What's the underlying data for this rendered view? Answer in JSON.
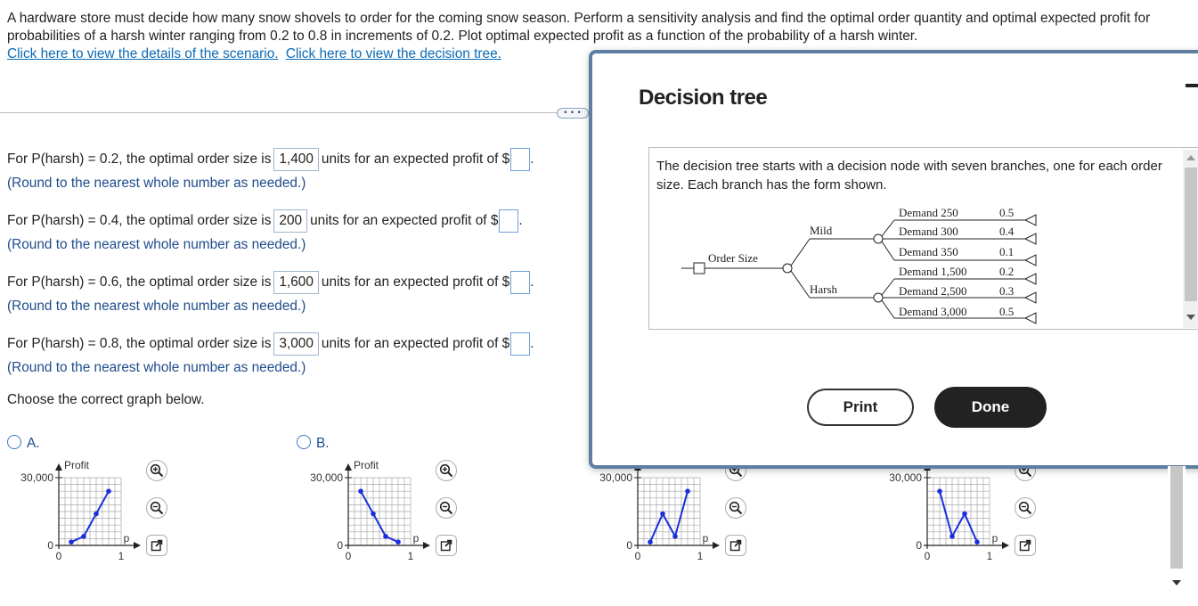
{
  "question": {
    "text": "A hardware store must decide how many snow shovels to order for the coming snow season. Perform a sensitivity analysis and find the optimal order quantity and optimal expected profit for probabilities of a harsh winter ranging from 0.2 to 0.8 in increments of 0.2. Plot optimal expected profit as a function of the probability of a harsh winter.",
    "link_scenario": "Click here to view the details of the scenario.",
    "link_tree": "Click here to view the decision tree."
  },
  "more_label": "• • •",
  "rows": [
    {
      "prefix": "For P(harsh) = 0.2, the optimal order size is",
      "answer": "1,400",
      "middle": "units for an expected profit of $",
      "suffix": ".",
      "hint": "(Round to the nearest whole number as needed.)"
    },
    {
      "prefix": "For P(harsh) = 0.4, the optimal order size is",
      "answer": "200",
      "middle": "units for an expected profit of $",
      "suffix": ".",
      "hint": "(Round to the nearest whole number as needed.)"
    },
    {
      "prefix": "For P(harsh) = 0.6, the optimal order size is",
      "answer": "1,600",
      "middle": "units for an expected profit of $",
      "suffix": ".",
      "hint": "(Round to the nearest whole number as needed.)"
    },
    {
      "prefix": "For P(harsh) = 0.8, the optimal order size is",
      "answer": "3,000",
      "middle": "units for an expected profit of $",
      "suffix": ".",
      "hint": "(Round to the nearest whole number as needed.)"
    }
  ],
  "choose_text": "Choose the correct graph below.",
  "options": [
    {
      "label": "A.",
      "ylabel": "Profit",
      "ytop": "30,000",
      "y0": "0",
      "x0": "0",
      "x1": "1",
      "xlabel": "p",
      "profits": [
        1500,
        4000,
        14000,
        24000
      ]
    },
    {
      "label": "B.",
      "ylabel": "Profit",
      "ytop": "30,000",
      "y0": "0",
      "x0": "0",
      "x1": "1",
      "xlabel": "p",
      "profits": [
        24000,
        14000,
        4000,
        1500
      ]
    },
    {
      "label": "",
      "ylabel": "",
      "ytop": "30,000",
      "y0": "0",
      "x0": "0",
      "x1": "1",
      "xlabel": "p",
      "profits": [
        1500,
        14000,
        4000,
        24000
      ]
    },
    {
      "label": "",
      "ylabel": "",
      "ytop": "30,000",
      "y0": "0",
      "x0": "0",
      "x1": "1",
      "xlabel": "p",
      "profits": [
        24000,
        4000,
        14000,
        1500
      ]
    }
  ],
  "modal": {
    "title": "Decision tree",
    "description": "The decision tree starts with a decision node with seven branches, one for each order size. Each branch has the form shown.",
    "tree": {
      "decision_label": "Order Size",
      "branches": [
        {
          "label": "Mild",
          "outcomes": [
            {
              "label": "Demand 250",
              "p": "0.5"
            },
            {
              "label": "Demand 300",
              "p": "0.4"
            },
            {
              "label": "Demand 350",
              "p": "0.1"
            }
          ]
        },
        {
          "label": "Harsh",
          "outcomes": [
            {
              "label": "Demand 1,500",
              "p": "0.2"
            },
            {
              "label": "Demand 2,500",
              "p": "0.3"
            },
            {
              "label": "Demand 3,000",
              "p": "0.5"
            }
          ]
        }
      ]
    },
    "print_label": "Print",
    "done_label": "Done"
  }
}
